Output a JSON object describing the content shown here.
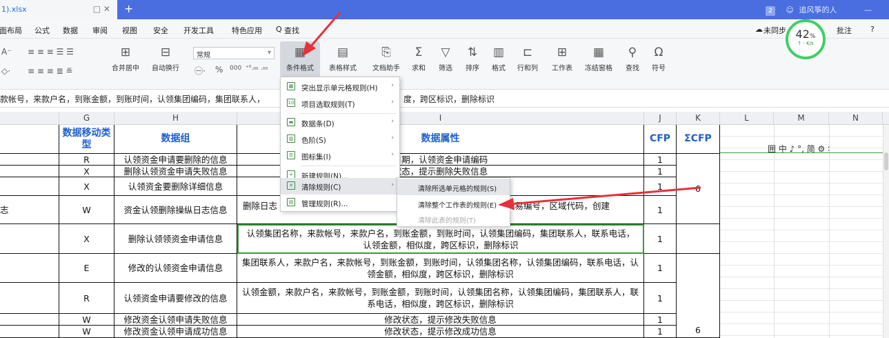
{
  "titlebar": {
    "filename": "1).xlsx",
    "tab_controls": "□ ✕",
    "new_tab": "+",
    "badge": "2",
    "user": "追风筝的人",
    "minimize": "—"
  },
  "menu": {
    "items": [
      "页面布局",
      "公式",
      "数据",
      "审阅",
      "视图",
      "安全",
      "开发工具",
      "特色应用",
      "查找"
    ],
    "sync": "未同步",
    "comment": "批注",
    "help": "?"
  },
  "ribbon": {
    "number_format": "常规",
    "merge": "合并居中",
    "wrap": "自动换行",
    "cond_format": "条件格式",
    "table_style": "表格样式",
    "doc_helper": "文档助手",
    "sum": "求和",
    "filter": "筛选",
    "sort": "排序",
    "format": "格式",
    "rowcol": "行和列",
    "sheet": "工作表",
    "freeze": "冻结窗格",
    "find": "查找",
    "symbol": "符号",
    "percent": "%",
    "thousands": "000"
  },
  "perf": {
    "value": "42",
    "unit": "%",
    "speed": "- K/s"
  },
  "formula_bar": {
    "text_left": "款帐号，来款户名，到账金额，到账时间，认领集团编码，集团联系人，",
    "text_right": "度，跨区标识，删除标识"
  },
  "columns": {
    "G": "G",
    "H": "H",
    "I": "I",
    "J": "J",
    "K": "K",
    "L": "L",
    "M": "M",
    "N": "N"
  },
  "table": {
    "header": {
      "move_type": "数据移动类型",
      "group": "数据组",
      "attr": "数据属性",
      "cfp": "CFP",
      "sum_cfp": "ΣCFP"
    },
    "rows": [
      {
        "left": "",
        "type": "R",
        "group": "认领资金申请要删除的信息",
        "attr": "日期，认领资金申请编码",
        "cfp": "1"
      },
      {
        "left": "",
        "type": "X",
        "group": "删除认领资金申请失败信息",
        "attr": "状态，提示删除失败信息",
        "cfp": "1"
      },
      {
        "left": "",
        "type": "X",
        "group": "认领资金要删除详细信息",
        "attr": "",
        "cfp": "1"
      },
      {
        "left": "志",
        "type": "W",
        "group": "资金认领删除操纵日志信息",
        "attr_left": "删除日志",
        "attr": "交易编号，区域代码，创建",
        "cfp": "1"
      },
      {
        "left": "",
        "type": "X",
        "group": "删除认领领资金申请信息",
        "attr": "认领集团名称，来款帐号，来款户名，到账金额，到账时间，认领集团编码，集团联系人，联系电话，认领金额，相似度，跨区标识，删除标识",
        "cfp": "1"
      },
      {
        "left": "",
        "type": "E",
        "group": "修改的认领资金申请信息",
        "attr": "集团联系人，来款户名，来款帐号，到账金额，到账时间，认领集团名称，认领集团编码，联系电话，认领金额，相似度，跨区标识，删除标识",
        "cfp": "1"
      },
      {
        "left": "",
        "type": "R",
        "group": "认领资金申请要修改的信息",
        "attr": "认领金额，来款户名，来款帐号，到账金额，到账时间，认领集团名称，认领集团编码，集团联系人，联系电话，相似度，跨区标识，删除标识",
        "cfp": "1"
      },
      {
        "left": "",
        "type": "W",
        "group": "修改资金认领申请失败信息",
        "attr": "修改状态，提示修改失败信息",
        "cfp": "1"
      },
      {
        "left": "",
        "type": "W",
        "group": "修改资金认领申请成功信息",
        "attr": "修改状态，提示修改成功信息",
        "cfp": "1"
      }
    ],
    "sum_top": "6",
    "sum_bottom": "6"
  },
  "cf_menu": {
    "items": [
      {
        "label": "突出显示单元格规则(H)",
        "arrow": "›"
      },
      {
        "label": "项目选取规则(T)",
        "arrow": "›"
      },
      {
        "label": "数据条(D)",
        "arrow": "›"
      },
      {
        "label": "色阶(S)",
        "arrow": "›"
      },
      {
        "label": "图标集(I)",
        "arrow": "›"
      },
      {
        "label": "新建规则(N)...",
        "arrow": ""
      },
      {
        "label": "清除规则(C)",
        "arrow": "›"
      },
      {
        "label": "管理规则(R)...",
        "arrow": ""
      }
    ]
  },
  "clear_submenu": {
    "items": [
      "清除所选单元格的规则(S)",
      "清除整个工作表的规则(E)",
      "清除此表的规则(T)"
    ]
  },
  "float_toolbar": "囲 中 ♪ °, 简 ⚙ ∶",
  "colors": {
    "titlebar": "#4a6ee0",
    "header_text": "#1f5fd0",
    "arrow": "#e8303a",
    "green": "#3fcf63"
  }
}
